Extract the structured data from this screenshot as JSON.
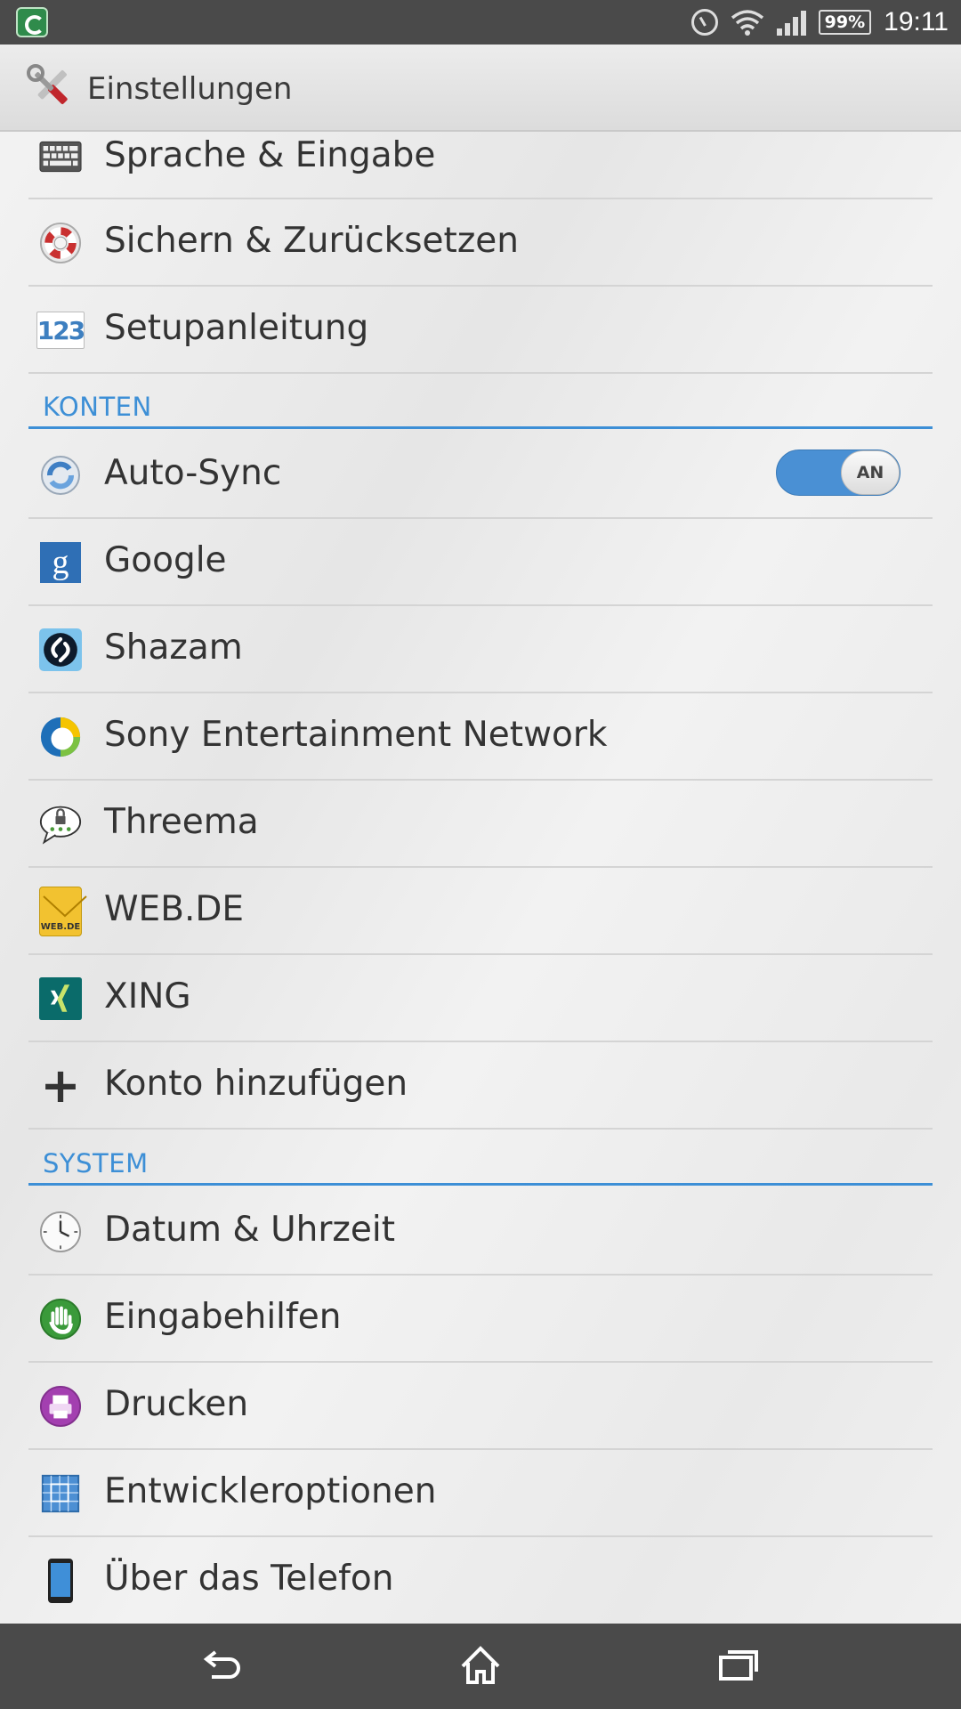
{
  "status_bar": {
    "battery": "99%",
    "time": "19:11"
  },
  "action_bar": {
    "title": "Einstellungen"
  },
  "items_top": [
    {
      "label": "Sprache & Eingabe",
      "icon": "keyboard-icon"
    },
    {
      "label": "Sichern & Zurücksetzen",
      "icon": "lifebuoy-icon"
    },
    {
      "label": "Setupanleitung",
      "icon": "setup-guide-icon"
    }
  ],
  "sections": {
    "accounts": "KONTEN",
    "system": "SYSTEM"
  },
  "auto_sync": {
    "label": "Auto-Sync",
    "toggle_state": "AN"
  },
  "accounts": [
    {
      "label": "Google",
      "icon": "google-icon"
    },
    {
      "label": "Shazam",
      "icon": "shazam-icon"
    },
    {
      "label": "Sony Entertainment Network",
      "icon": "sony-network-icon"
    },
    {
      "label": "Threema",
      "icon": "threema-icon"
    },
    {
      "label": "WEB.DE",
      "icon": "webde-icon",
      "icon_text": "WEB.DE"
    },
    {
      "label": "XING",
      "icon": "xing-icon"
    }
  ],
  "add_account": {
    "label": "Konto hinzufügen"
  },
  "system": [
    {
      "label": "Datum & Uhrzeit",
      "icon": "clock-icon"
    },
    {
      "label": "Eingabehilfen",
      "icon": "accessibility-icon"
    },
    {
      "label": "Drucken",
      "icon": "print-icon"
    },
    {
      "label": "Entwickleroptionen",
      "icon": "developer-icon"
    },
    {
      "label": "Über das Telefon",
      "icon": "phone-icon"
    }
  ],
  "icon_glyphs": {
    "setup": "123",
    "google": "g",
    "plus": "+"
  },
  "colors": {
    "accent": "#3d8fd6",
    "status_bar": "#4a4a4a",
    "toggle_on": "#4a90d4"
  }
}
